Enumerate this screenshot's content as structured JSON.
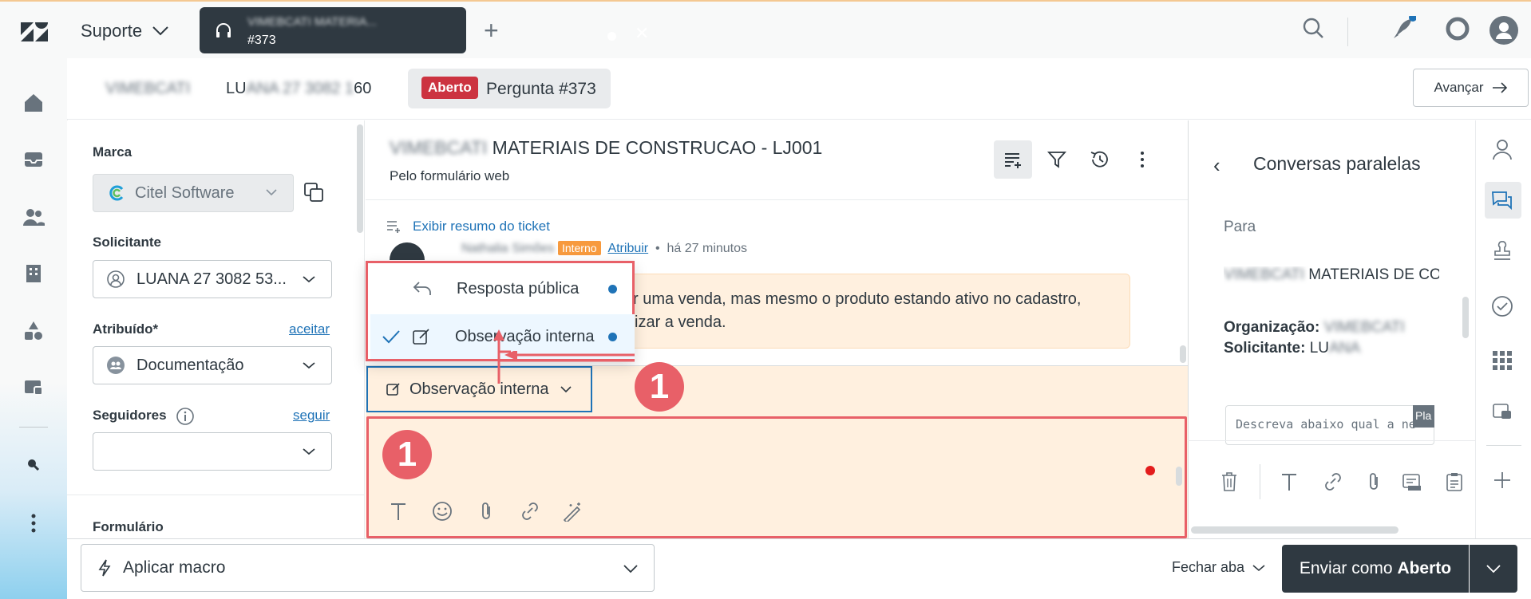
{
  "topbar": {
    "product": "Suporte",
    "ticket_tab_title": "VIMEBCATI MATERIA...",
    "ticket_tab_number": "#373"
  },
  "breadcrumb": {
    "org": "VIMEBCATI",
    "requester_prefix": "LU",
    "requester_blur": "ANA 27 3082 1",
    "requester_suffix": "60",
    "status": "Aberto",
    "title": "Pergunta #373",
    "next": "Avançar"
  },
  "props": {
    "brand_label": "Marca",
    "brand_value": "Citel Software",
    "requester_label": "Solicitante",
    "requester_value": "LUANA 27 3082 53...",
    "assignee_label": "Atribuído*",
    "assignee_link": "aceitar",
    "assignee_value": "Documentação",
    "followers_label": "Seguidores",
    "followers_link": "seguir",
    "form_label": "Formulário"
  },
  "conversation": {
    "title_blur": "VIMEBCATI",
    "title": "MATERIAIS DE CONSTRUCAO - LJ001",
    "subtitle": "Pelo formulário web",
    "summary_link": "Exibir resumo do ticket",
    "meta_author": "Nathalia Simões",
    "meta_tag": "Interno",
    "meta_assign": "Atribuir",
    "meta_time": "há 27 minutos",
    "msg_line1": "r uma venda, mas mesmo o produto estando ativo no cadastro,",
    "msg_line2": "izar a venda."
  },
  "menu": {
    "item_public": "Resposta pública",
    "item_internal": "Observação interna"
  },
  "composer": {
    "type_label": "Observação interna"
  },
  "annotations": {
    "badge_dropdown": "1",
    "badge_editor": "1"
  },
  "side": {
    "title": "Conversas paralelas",
    "to_label": "Para",
    "to_blur": "VIMEBCATI",
    "to_value": "MATERIAIS DE CO",
    "org_label": "Organização:",
    "org_value": "VIMEBCATI",
    "req_label": "Solicitante:",
    "req_value": "LU",
    "req_blur": "ANA",
    "input_placeholder": "Descreva abaixo qual a ne",
    "tag": "Pla"
  },
  "bottom": {
    "macro": "Aplicar macro",
    "close_tab": "Fechar aba",
    "send_prefix": "Enviar como ",
    "send_status": "Aberto"
  },
  "colors": {
    "dark": "#2f3941",
    "link": "#1f73b7",
    "internal_note_bg": "#fff0df",
    "annotation_red": "#e86068",
    "status_open": "#cc3340"
  }
}
